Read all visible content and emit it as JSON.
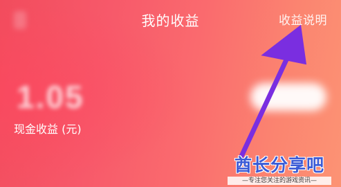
{
  "header": {
    "title": "我的收益",
    "rules_link": "收益说明"
  },
  "earnings": {
    "amount": "1.05",
    "label": "现金收益 (元)"
  },
  "watermark": {
    "title": "酋长分享吧",
    "subtitle": "—专注您关注的游戏资讯—"
  },
  "colors": {
    "background_start": "#f24c5d",
    "background_end": "#fc9374",
    "arrow": "#7a2ee0",
    "watermark_text": "#3b5bd6"
  },
  "icons": {
    "back": "back-arrow-icon",
    "annotation": "annotation-arrow-icon"
  }
}
